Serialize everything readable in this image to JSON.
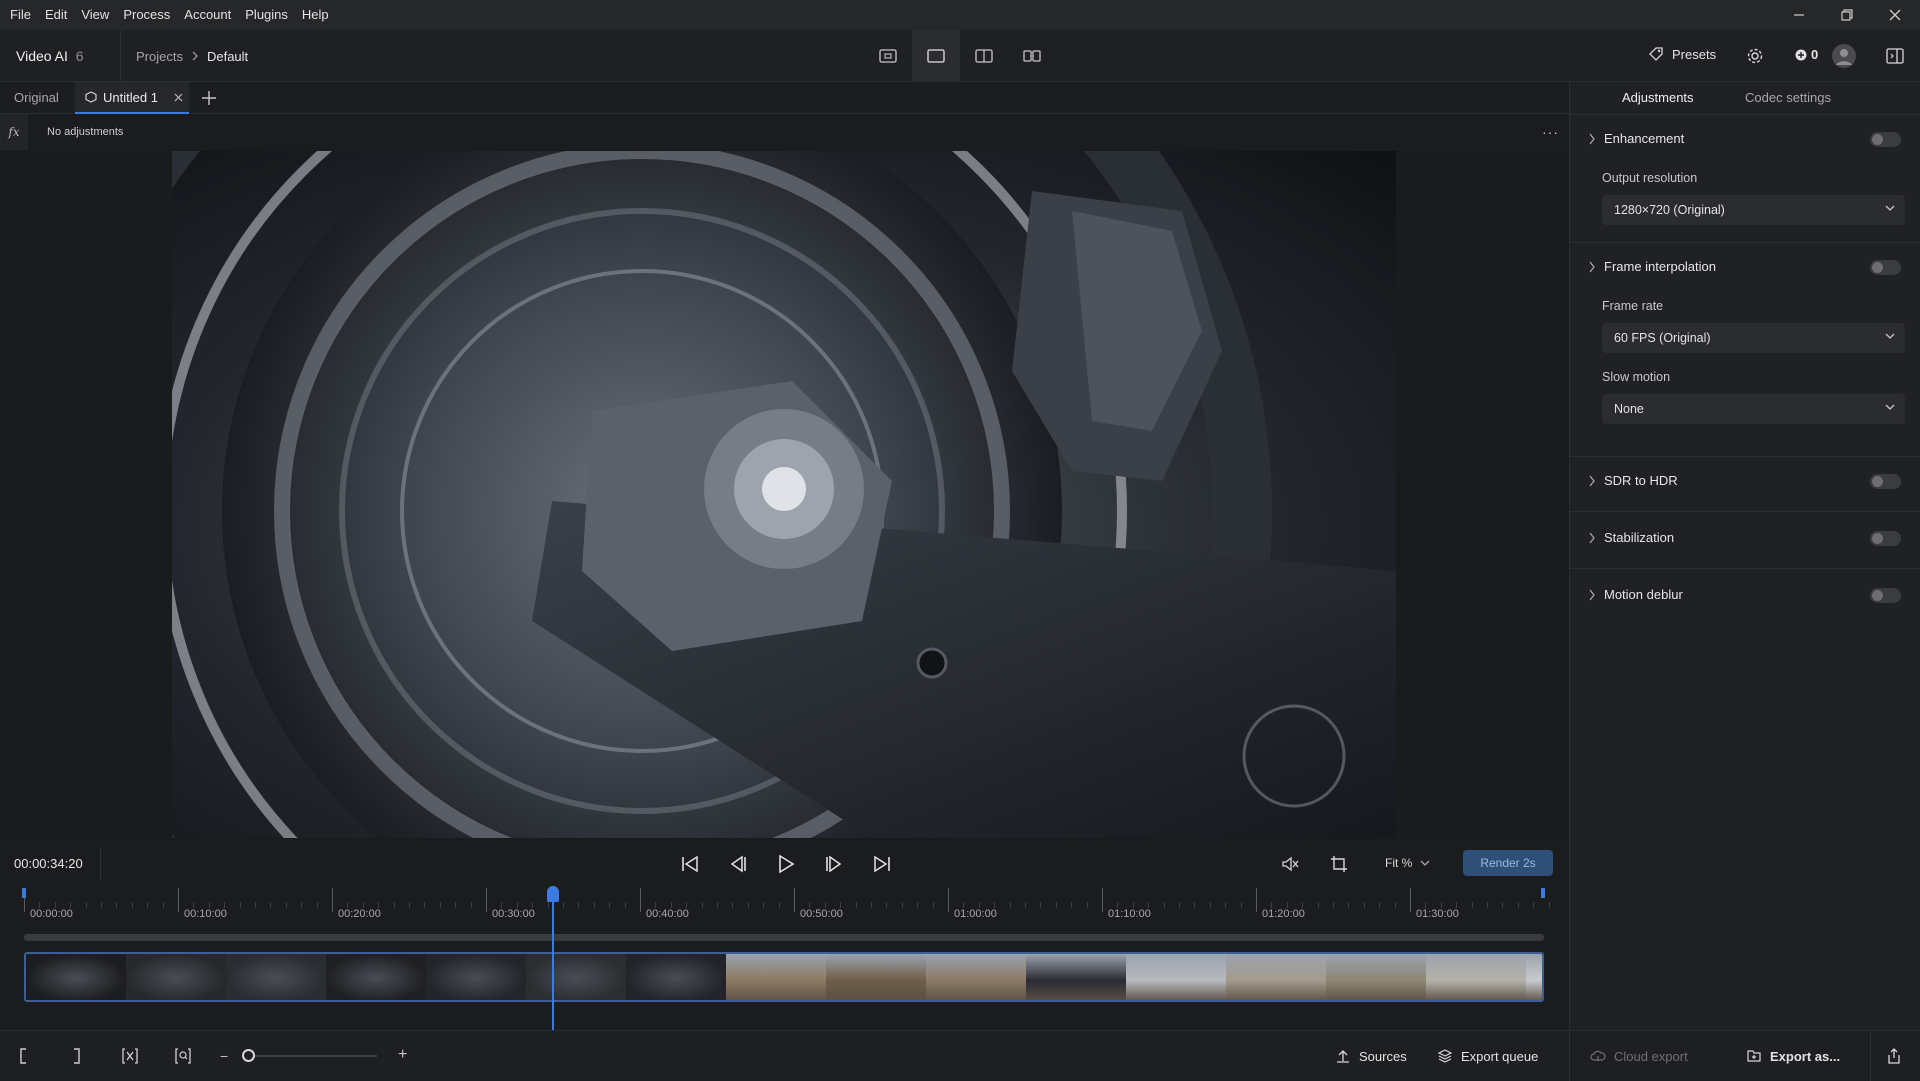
{
  "menu": [
    "File",
    "Edit",
    "View",
    "Process",
    "Account",
    "Plugins",
    "Help"
  ],
  "app": {
    "name": "Video AI",
    "version": "6"
  },
  "breadcrumb": {
    "root": "Projects",
    "current": "Default"
  },
  "toolbar": {
    "presets_label": "Presets",
    "credits": "0"
  },
  "tabs": {
    "original": "Original",
    "active": "Untitled 1"
  },
  "adjustments_text": "No adjustments",
  "transport": {
    "timecode": "00:00:34:20",
    "zoom": "Fit %",
    "render_label": "Render 2s"
  },
  "timeline": {
    "ticks": [
      "00:00:00",
      "00:10:00",
      "00:20:00",
      "00:30:00",
      "00:40:00",
      "00:50:00",
      "01:00:00",
      "01:10:00",
      "01:20:00",
      "01:30:00"
    ],
    "playhead_time": "00:00:34:20"
  },
  "panel": {
    "tabs": [
      "Adjustments",
      "Codec settings"
    ],
    "enhancement": "Enhancement",
    "output_resolution_label": "Output resolution",
    "output_resolution_value": "1280×720 (Original)",
    "frame_interpolation": "Frame interpolation",
    "frame_rate_label": "Frame rate",
    "frame_rate_value": "60 FPS (Original)",
    "slow_motion_label": "Slow motion",
    "slow_motion_value": "None",
    "sdr_to_hdr": "SDR to HDR",
    "stabilization": "Stabilization",
    "motion_deblur": "Motion deblur"
  },
  "bottombar": {
    "sources": "Sources",
    "export_queue": "Export queue",
    "cloud_export": "Cloud export",
    "export_as": "Export as..."
  },
  "colors": {
    "accent": "#3d7be0",
    "render_bg": "#2d4f78",
    "panel_bg": "#202124"
  },
  "icons": [
    "minimize-icon",
    "restore-icon",
    "close-icon",
    "presets-icon",
    "gear-icon",
    "credits-icon",
    "avatar-icon",
    "panel-toggle-icon",
    "fx-icon",
    "more-icon",
    "skip-start-icon",
    "step-back-icon",
    "play-icon",
    "step-forward-icon",
    "skip-end-icon",
    "mute-icon",
    "crop-icon",
    "sources-icon",
    "export-queue-icon",
    "cloud-icon",
    "export-icon",
    "share-icon"
  ]
}
